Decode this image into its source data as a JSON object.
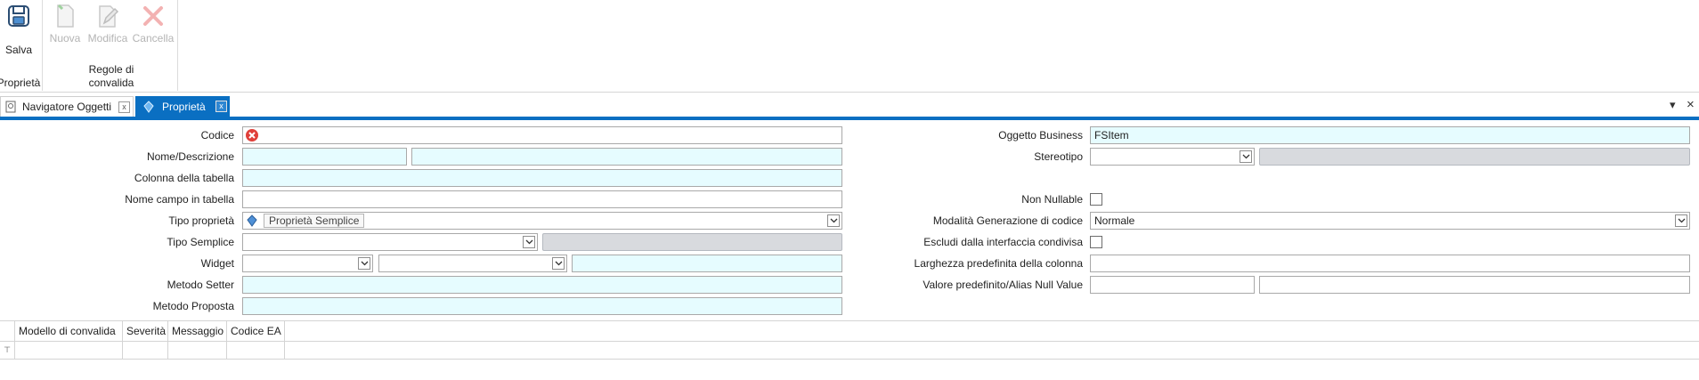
{
  "ribbon": {
    "save_label": "Salva",
    "group_properties_label": "Proprietà",
    "new_label": "Nuova",
    "edit_label": "Modifica",
    "delete_label": "Cancella",
    "group_validation_label": "Regole di convalida"
  },
  "tabs": [
    {
      "label": "Navigatore Oggetti",
      "close": "x"
    },
    {
      "label": "Proprietà",
      "close": "x"
    }
  ],
  "window_controls": {
    "dropdown": "▾",
    "close": "×"
  },
  "form": {
    "codice_label": "Codice",
    "nome_descrizione_label": "Nome/Descrizione",
    "colonna_label": "Colonna della tabella",
    "nome_campo_label": "Nome campo in tabella",
    "tipo_proprieta_label": "Tipo proprietà",
    "tipo_proprieta_value": "Proprietà Semplice",
    "tipo_semplice_label": "Tipo Semplice",
    "widget_label": "Widget",
    "metodo_setter_label": "Metodo Setter",
    "metodo_proposta_label": "Metodo Proposta",
    "oggetto_business_label": "Oggetto Business",
    "oggetto_business_value": "FSItem",
    "stereotipo_label": "Stereotipo",
    "non_nullable_label": "Non Nullable",
    "modalita_label": "Modalità Generazione di codice",
    "modalita_value": "Normale",
    "escludi_label": "Escludi dalla interfaccia condivisa",
    "larghezza_label": "Larghezza predefinita della colonna",
    "valore_label": "Valore predefinito/Alias Null Value"
  },
  "grid": {
    "columns": [
      "Modello di convalida",
      "Severità",
      "Messaggio",
      "Codice EA"
    ],
    "filter_icon": "⊤"
  },
  "colors": {
    "accent": "#0a6fc2",
    "field_bg": "#e6fcff",
    "error": "#e0403a"
  }
}
